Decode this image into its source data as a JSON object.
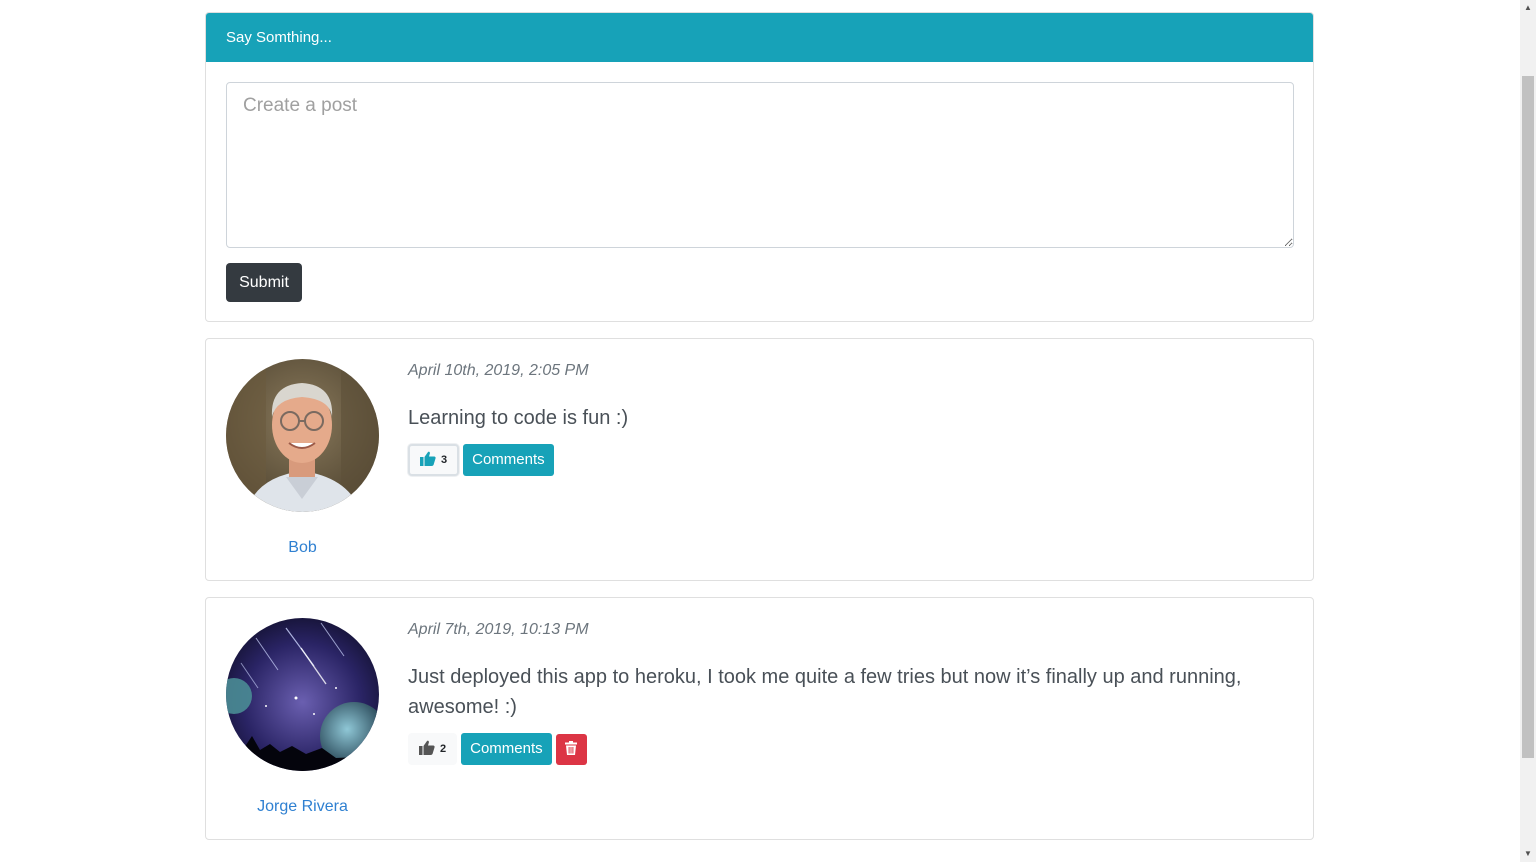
{
  "create_post": {
    "header": "Say Somthing...",
    "placeholder": "Create a post",
    "submit_label": "Submit"
  },
  "posts": [
    {
      "author": "Bob",
      "date": "April 10th, 2019, 2:05 PM",
      "text": "Learning to code is fun :)",
      "likes": "3",
      "comments_label": "Comments",
      "liked": true,
      "deletable": false
    },
    {
      "author": "Jorge Rivera",
      "date": "April 7th, 2019, 10:13 PM",
      "text": "Just deployed this app to heroku, I took me quite a few tries but now it’s finally up and running, awesome! :)",
      "likes": "2",
      "comments_label": "Comments",
      "liked": false,
      "deletable": true
    }
  ],
  "colors": {
    "header": "#17a2b8",
    "submit": "#343a40",
    "delete": "#dc3545",
    "link": "#2f80d1"
  },
  "icons": {
    "like": "thumbs-up-icon",
    "delete": "trash-icon"
  }
}
